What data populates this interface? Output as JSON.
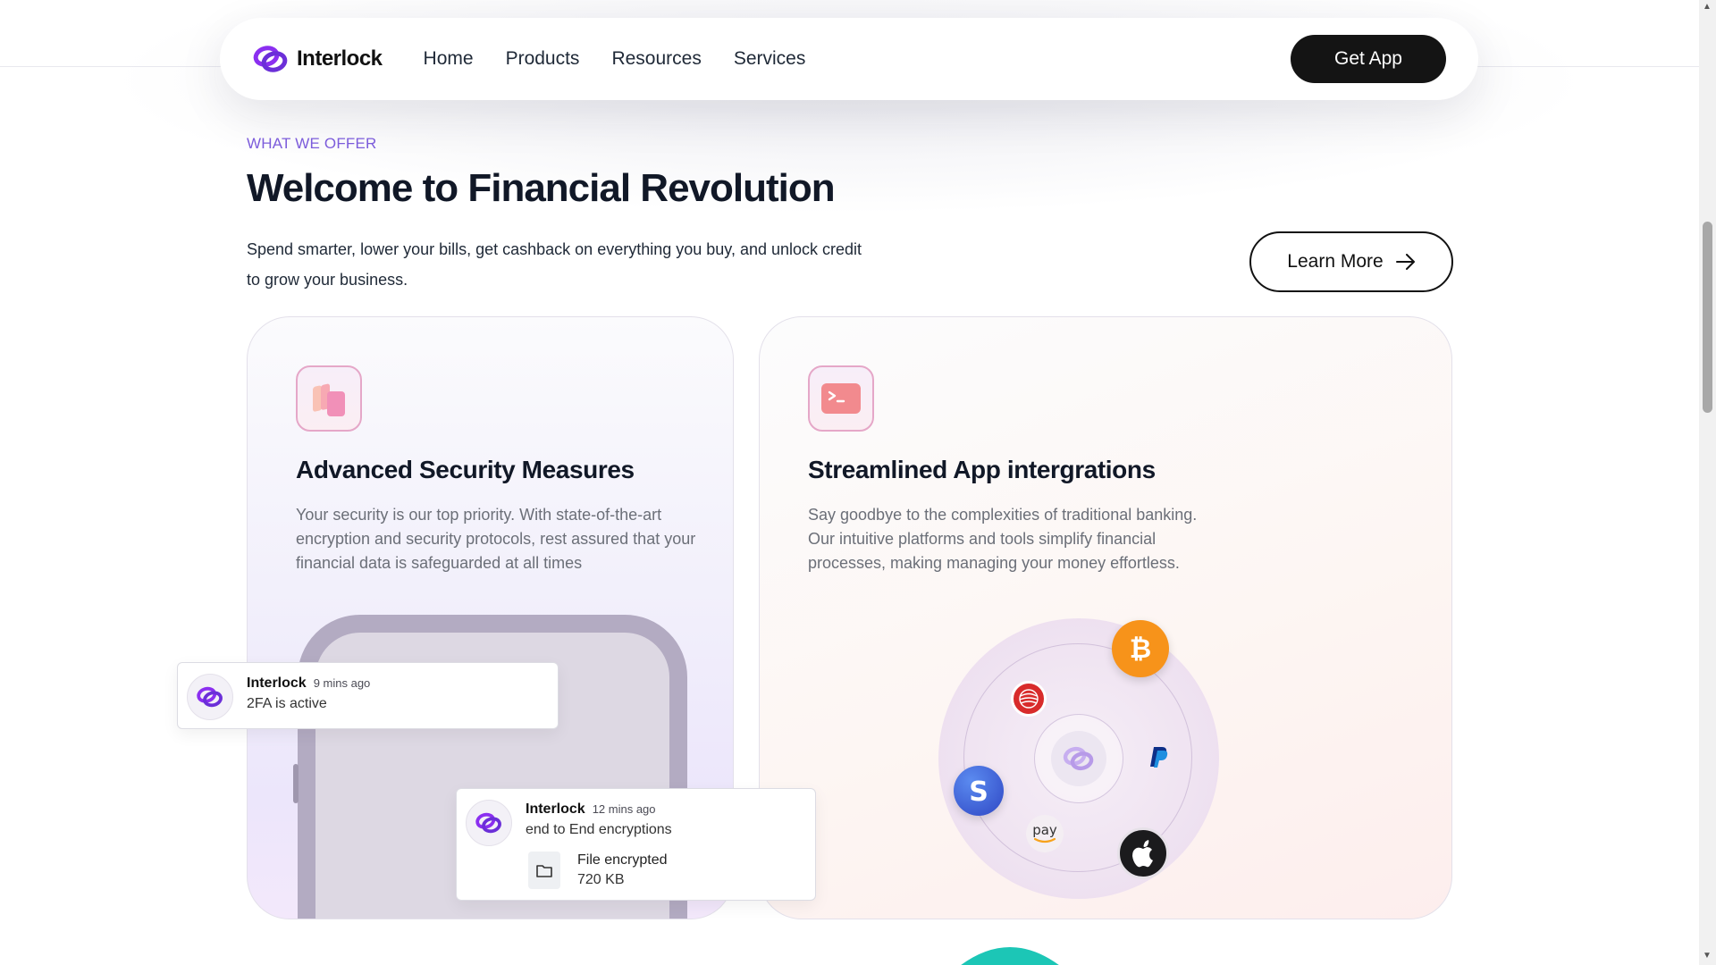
{
  "nav": {
    "brand": "Interlock",
    "items": [
      "Home",
      "Products",
      "Resources",
      "Services"
    ],
    "cta": "Get App"
  },
  "hero": {
    "eyebrow": "WHAT WE OFFER",
    "title": "Welcome to Financial Revolution",
    "subtitle_line1": "Spend smarter, lower your bills, get cashback on everything you buy, and unlock credit",
    "subtitle_line2": "to grow your business.",
    "learn_more": "Learn More"
  },
  "cards": [
    {
      "icon": "stack-icon",
      "title": "Advanced Security Measures",
      "text": "Your security is our top priority. With state-of-the-art encryption and security protocols, rest assured that your financial data is safeguarded at all times"
    },
    {
      "icon": "terminal-icon",
      "title": "Streamlined App intergrations",
      "text": "Say goodbye to the complexities of traditional banking. Our intuitive platforms and tools simplify financial processes, making managing your money effortless."
    }
  ],
  "notifications": [
    {
      "sender": "Interlock",
      "time": "9 mins ago",
      "body": "2FA is active"
    },
    {
      "sender": "Interlock",
      "time": "12 mins ago",
      "body": "end to End encryptions",
      "file_name": "File encrypted",
      "file_size": "720 KB"
    }
  ],
  "integrations": [
    "bitcoin-icon",
    "globe-icon",
    "paypal-icon",
    "stripe-icon",
    "amazon-pay-icon",
    "apple-icon",
    "interlock-logo-icon"
  ],
  "integration_labels": {
    "amazon_pay": "pay"
  },
  "colors": {
    "accent": "#7c3aed",
    "eyebrow": "#7c5cdb",
    "button_dark": "#141414",
    "bitcoin": "#f7931a",
    "stripe": "#3b5bdb"
  }
}
